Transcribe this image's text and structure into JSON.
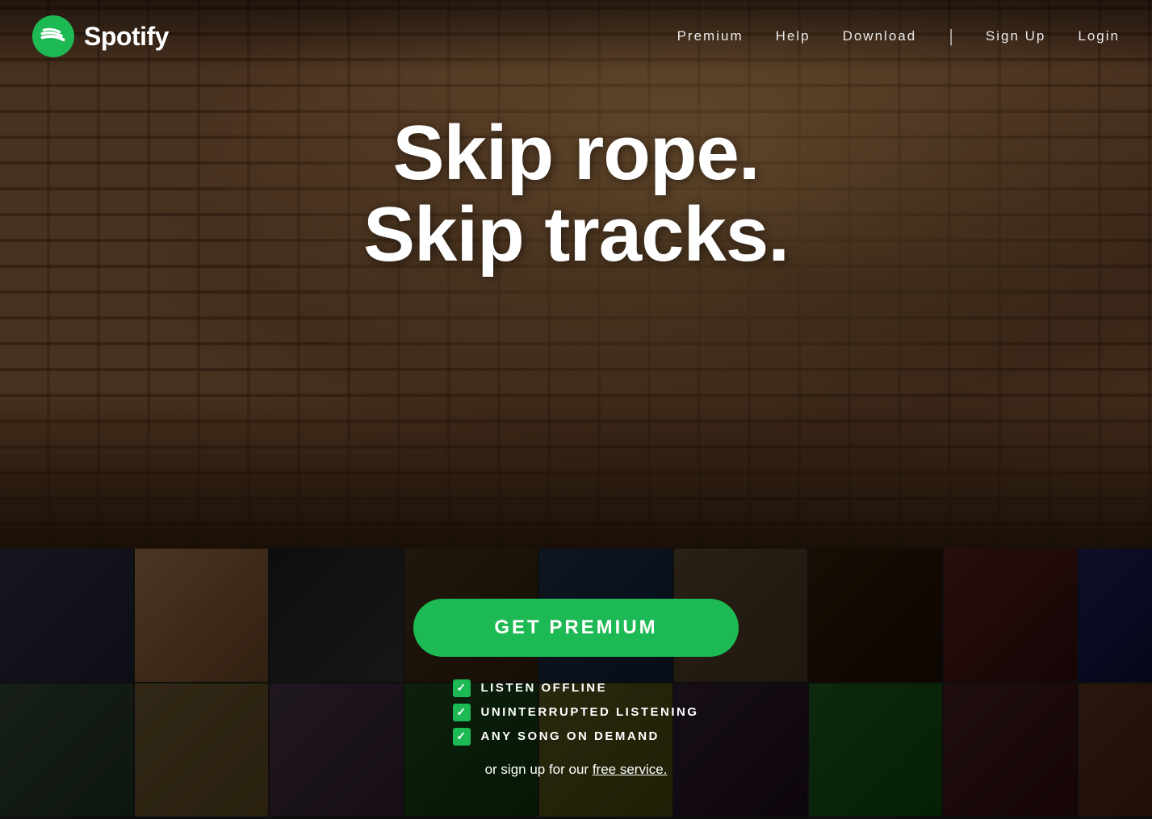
{
  "nav": {
    "logo_text": "Spotify",
    "links": [
      {
        "id": "premium",
        "label": "Premium"
      },
      {
        "id": "help",
        "label": "Help"
      },
      {
        "id": "download",
        "label": "Download"
      },
      {
        "id": "signup",
        "label": "Sign Up"
      },
      {
        "id": "login",
        "label": "Login"
      }
    ]
  },
  "hero": {
    "title_line1": "Skip rope.",
    "title_line2": "Skip tracks."
  },
  "cta": {
    "button_label": "GET PREMIUM",
    "features": [
      {
        "id": "offline",
        "text": "LISTEN OFFLINE"
      },
      {
        "id": "uninterrupted",
        "text": "UNINTERRUPTED LISTENING"
      },
      {
        "id": "on_demand",
        "text": "ANY SONG ON DEMAND"
      }
    ],
    "signup_prefix": "or sign up for our ",
    "signup_link_text": "free service.",
    "signup_suffix": ""
  },
  "albums": {
    "row1": [
      "a1",
      "a2",
      "a3",
      "a4",
      "a5",
      "a6",
      "a7",
      "a8",
      "a9",
      "a10"
    ],
    "row2": [
      "a11",
      "a12",
      "a13",
      "a14",
      "a15",
      "a16",
      "a17",
      "a18",
      "a19",
      "a20"
    ]
  }
}
